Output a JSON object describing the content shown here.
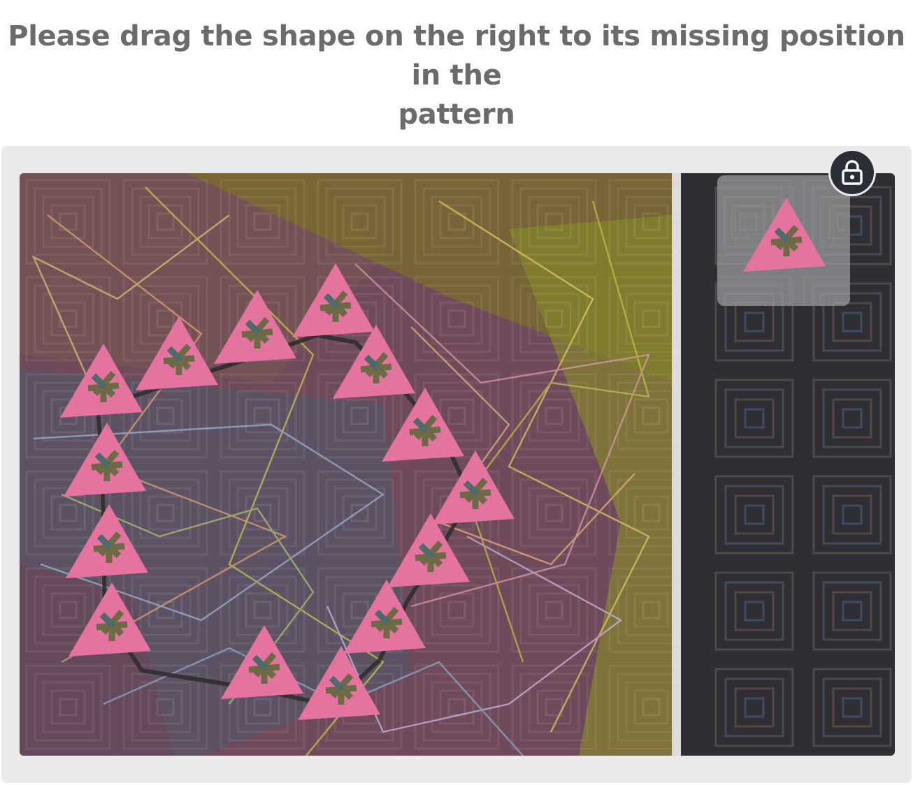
{
  "instruction": {
    "line1": "Please drag the shape on the right to its missing position in the",
    "line2": "pattern"
  },
  "icons": {
    "lock": "lock-icon"
  },
  "colors": {
    "panel": "#eaeaea",
    "board_background": "#6f4a5a",
    "shape_fill": "#e97aa4",
    "shape_mark": "#7a6a40",
    "side_strip": "#2f2f33",
    "lock_button": "#2a2e36",
    "instruction_text": "#6b6b6b"
  }
}
